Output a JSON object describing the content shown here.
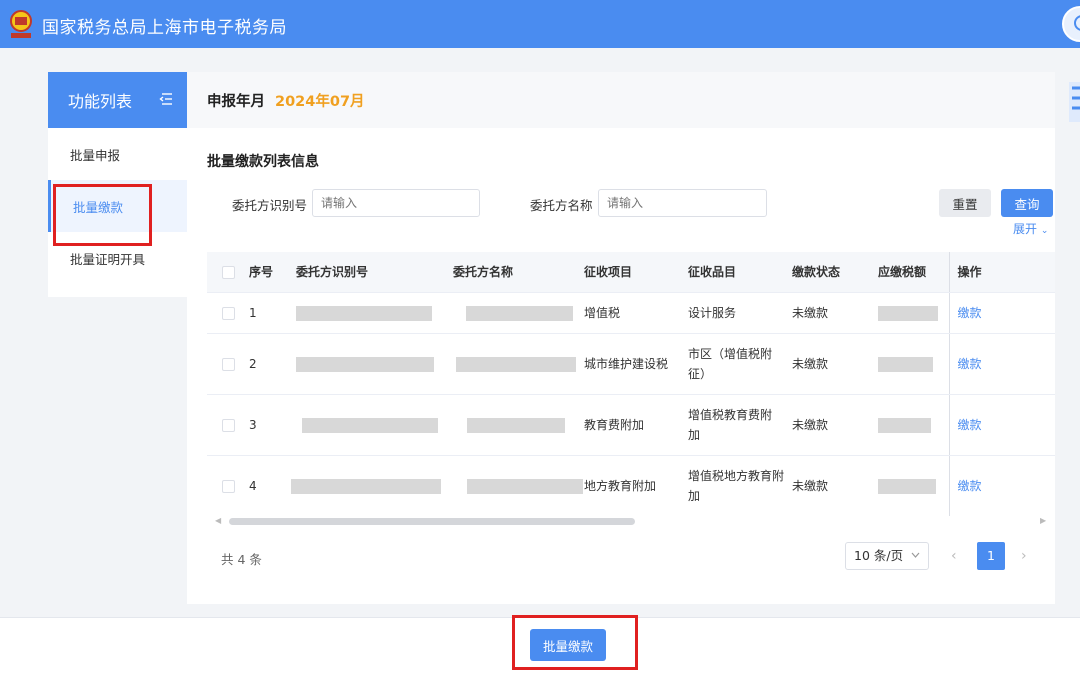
{
  "header": {
    "title": "国家税务总局上海市电子税务局"
  },
  "sidebar": {
    "title": "功能列表",
    "items": [
      {
        "label": "批量申报"
      },
      {
        "label": "批量缴款"
      },
      {
        "label": "批量证明开具"
      }
    ]
  },
  "period": {
    "label": "申报年月",
    "value": "2024年07月"
  },
  "section": {
    "title": "批量缴款列表信息"
  },
  "filters": {
    "id_label": "委托方识别号",
    "id_placeholder": "请输入",
    "name_label": "委托方名称",
    "name_placeholder": "请输入",
    "reset": "重置",
    "query": "查询",
    "expand": "展开"
  },
  "table": {
    "headers": [
      "序号",
      "委托方识别号",
      "委托方名称",
      "征收项目",
      "征收品目",
      "缴款状态",
      "应缴税额",
      "操作"
    ],
    "rows": [
      {
        "no": "1",
        "item": "增值税",
        "subitem": "设计服务",
        "status": "未缴款",
        "action": "缴款"
      },
      {
        "no": "2",
        "item": "城市维护建设税",
        "subitem": "市区（增值税附征）",
        "status": "未缴款",
        "action": "缴款"
      },
      {
        "no": "3",
        "item": "教育费附加",
        "subitem": "增值税教育费附加",
        "status": "未缴款",
        "action": "缴款"
      },
      {
        "no": "4",
        "item": "地方教育附加",
        "subitem": "增值税地方教育附加",
        "status": "未缴款",
        "action": "缴款"
      }
    ]
  },
  "pagination": {
    "total": "共 4 条",
    "page_size": "10 条/页",
    "current": "1"
  },
  "footer": {
    "batch_pay": "批量缴款"
  },
  "colors": {
    "primary": "#4a8cf0",
    "accent": "#f0a020",
    "highlight": "#e02020"
  }
}
